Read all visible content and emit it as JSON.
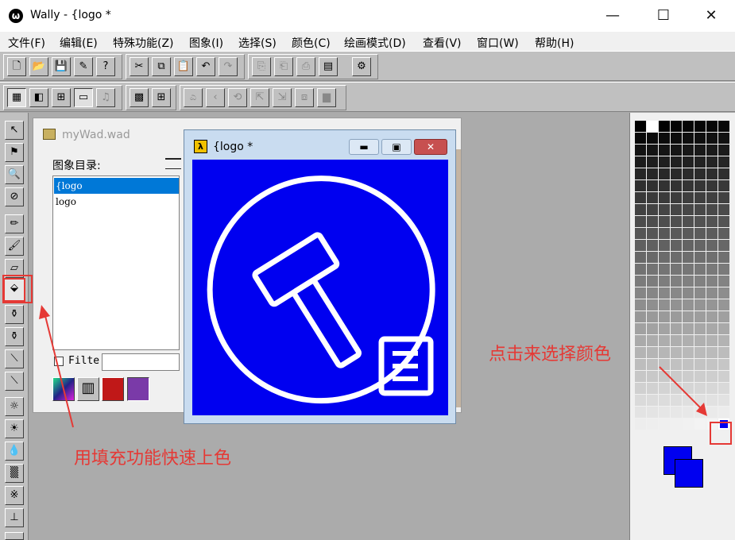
{
  "app": {
    "title": "Wally - {logo *"
  },
  "window_controls": {
    "minimize": "—",
    "maximize": "☐",
    "close": "✕"
  },
  "menu": [
    "文件(F)",
    "编辑(E)",
    "特殊功能(Z)",
    "图象(I)",
    "选择(S)",
    "颜色(C)",
    "绘画模式(D)",
    "查看(V)",
    "窗口(W)",
    "帮助(H)"
  ],
  "wad_window": {
    "title": "myWad.wad",
    "list_label": "图象目录:",
    "items": [
      "{logo",
      "logo"
    ],
    "selected_index": 0,
    "filter_label": "Filte",
    "filter_value": ""
  },
  "logo_window": {
    "title": "{logo *"
  },
  "palette": {
    "foreground": "#0000f0",
    "background": "#0000f0"
  },
  "annotations": {
    "fill_tool": "用填充功能快速上色",
    "pick_color": "点击来选择颜色"
  },
  "colors": {
    "canvas": "#0000f0",
    "accent": "#e53935",
    "selection": "#0078d7"
  }
}
